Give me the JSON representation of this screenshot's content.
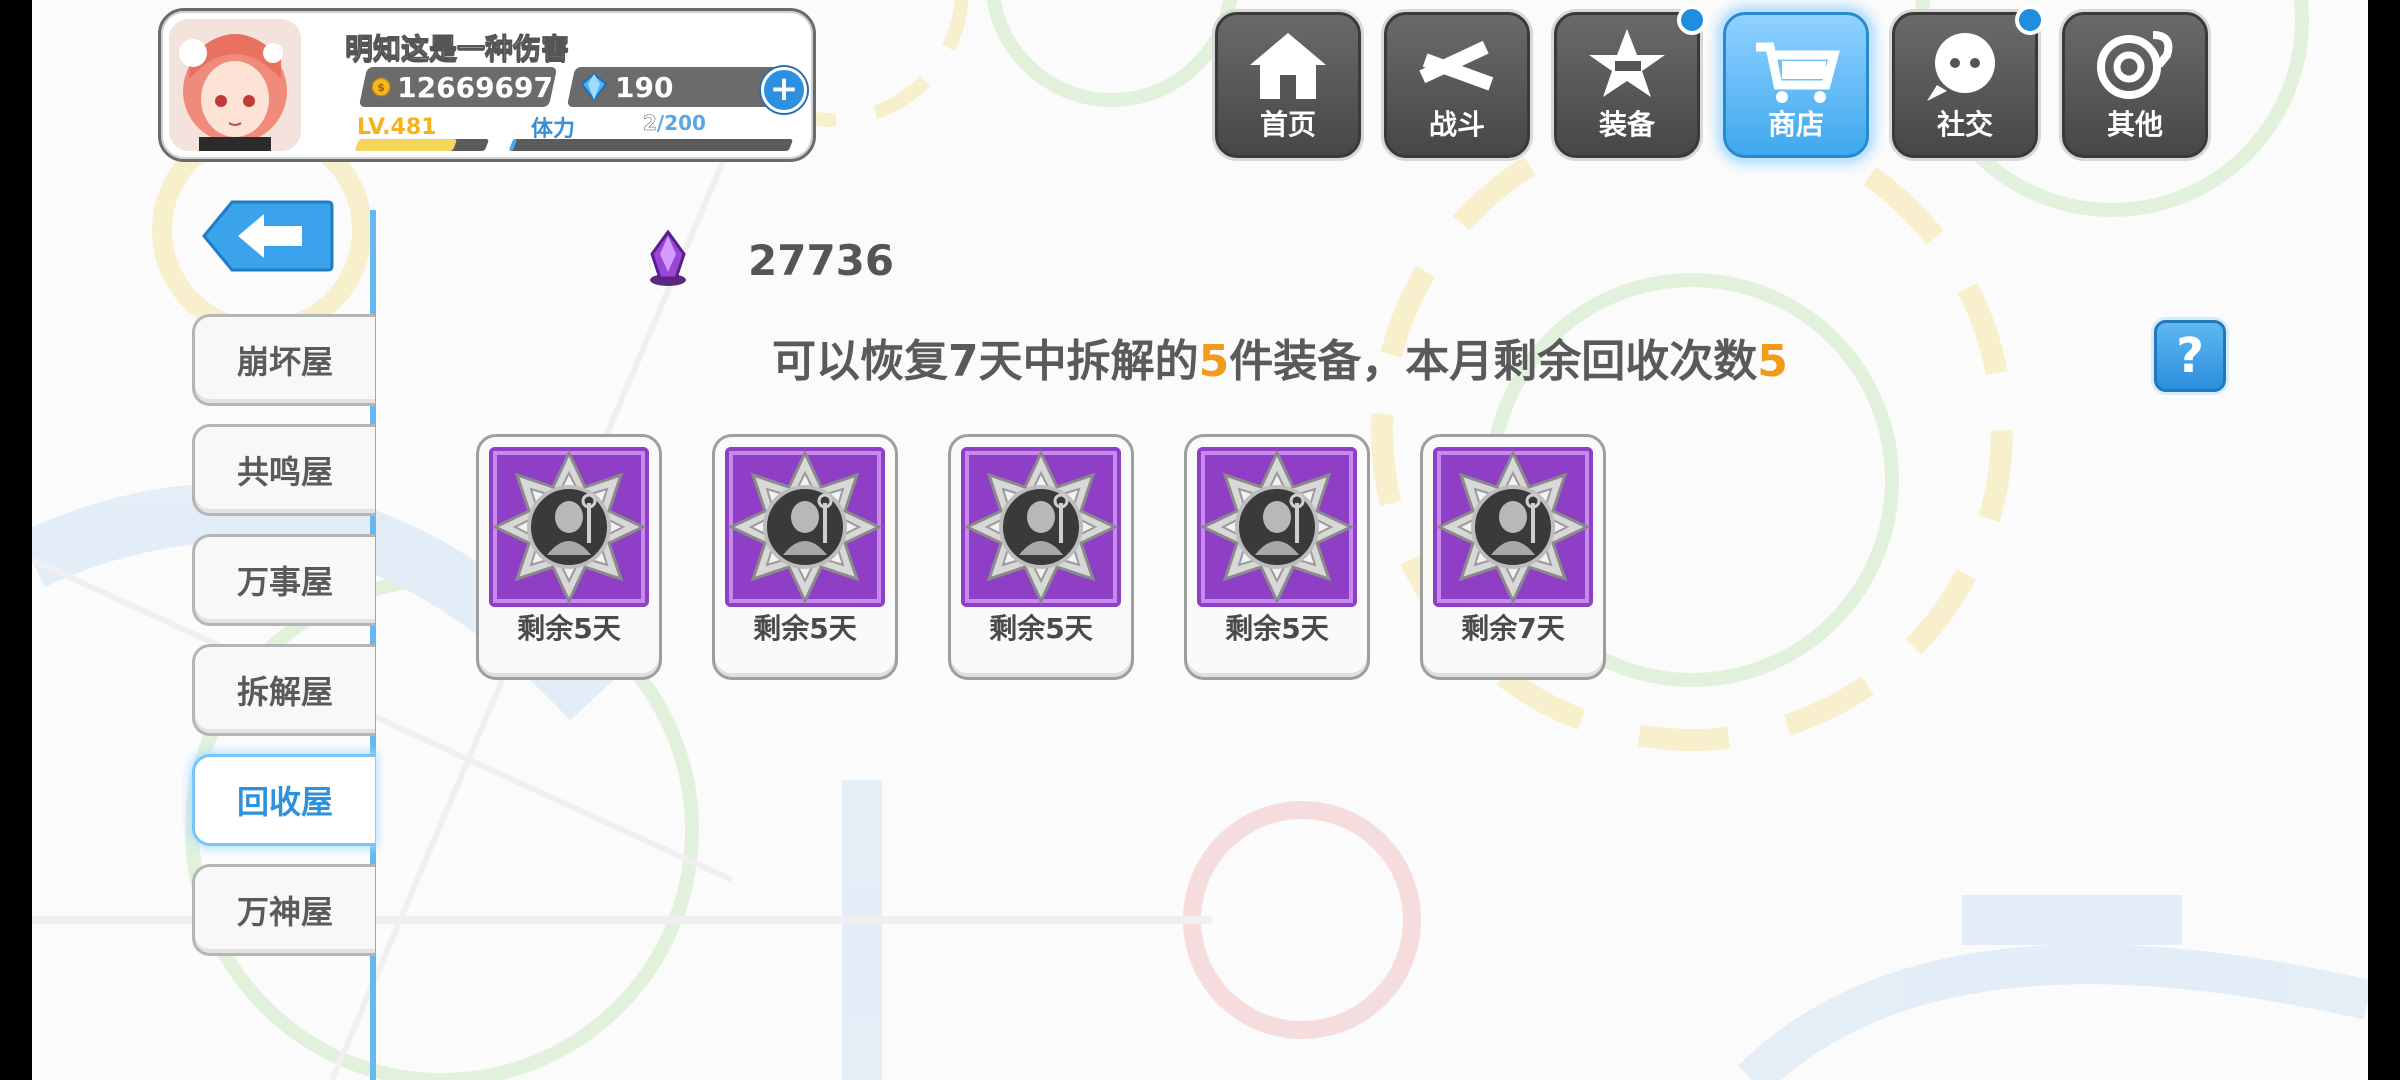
{
  "player": {
    "name": "明知这是一种伤害",
    "gold": "12669697",
    "gems": "190",
    "level": "LV.481",
    "stamina_label": "体力",
    "stamina_current": "2",
    "stamina_max": "/200",
    "exp_progress": 0.75,
    "stamina_progress": 0.01
  },
  "nav": [
    {
      "label": "首页",
      "icon": "house-icon",
      "active": false,
      "badge": false
    },
    {
      "label": "战斗",
      "icon": "crossed-guns-icon",
      "active": false,
      "badge": false
    },
    {
      "label": "装备",
      "icon": "star-gun-icon",
      "active": false,
      "badge": true
    },
    {
      "label": "商店",
      "icon": "shopping-cart-icon",
      "active": true,
      "badge": false
    },
    {
      "label": "社交",
      "icon": "social-face-icon",
      "active": false,
      "badge": true
    },
    {
      "label": "其他",
      "icon": "target-icon",
      "active": false,
      "badge": false
    }
  ],
  "side_menu": [
    {
      "label": "崩坏屋",
      "active": false
    },
    {
      "label": "共鸣屋",
      "active": false
    },
    {
      "label": "万事屋",
      "active": false
    },
    {
      "label": "拆解屋",
      "active": false
    },
    {
      "label": "回收屋",
      "active": true
    },
    {
      "label": "万神屋",
      "active": false
    }
  ],
  "currency": {
    "icon": "purple-crystal-icon",
    "value": "27736"
  },
  "info": {
    "part1": "可以恢复7天中拆解的",
    "count": "5",
    "part2": "件装备，本月剩余回收次数",
    "remaining": "5"
  },
  "help_label": "?",
  "equipment": [
    {
      "days_left": "剩余5天"
    },
    {
      "days_left": "剩余5天"
    },
    {
      "days_left": "剩余5天"
    },
    {
      "days_left": "剩余5天"
    },
    {
      "days_left": "剩余7天"
    }
  ],
  "colors": {
    "accent": "#2c92de",
    "highlight": "#f29a1a",
    "frame_purple": "#8e3fc6"
  }
}
